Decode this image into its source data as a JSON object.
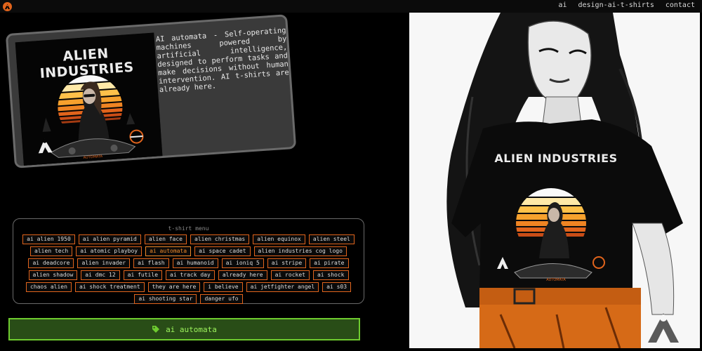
{
  "nav": {
    "links": [
      "ai",
      "design-ai-t-shirts",
      "contact"
    ]
  },
  "card": {
    "brand": "ALIEN INDUSTRIES",
    "small_caption": "AUTOMATA",
    "description": "AI automata - Self-operating machines powered by artificial intelligence, designed to perform tasks and make decisions without human intervention. AI t-shirts are already here."
  },
  "menu": {
    "title": "t-shirt menu",
    "items": [
      "ai alien 1950",
      "ai alien pyramid",
      "alien face",
      "alien christmas",
      "alien equinox",
      "alien steel",
      "alien tech",
      "ai atomic playboy",
      "ai automata",
      "ai space cadet",
      "alien industries cog logo",
      "ai deadcore",
      "alien invader",
      "ai flash",
      "ai humanoid",
      "ai ioniq 5",
      "ai stripe",
      "ai pirate",
      "alien shadow",
      "ai dmc 12",
      "ai futile",
      "ai track day",
      "already here",
      "ai rocket",
      "ai shock",
      "chaos alien",
      "ai shock treatment",
      "they are here",
      "i believe",
      "ai jetfighter angel",
      "ai s03",
      "ai shooting star",
      "danger ufo"
    ],
    "active_item": "ai automata"
  },
  "current": {
    "label": "ai automata"
  },
  "poster": {
    "brand": "ALIEN INDUSTRIES",
    "small_caption": "AUTOMATA"
  },
  "colors": {
    "accent": "#e1641c",
    "button_bg": "#294d17",
    "button_border": "#6ecb2f",
    "button_text": "#9df45c"
  }
}
